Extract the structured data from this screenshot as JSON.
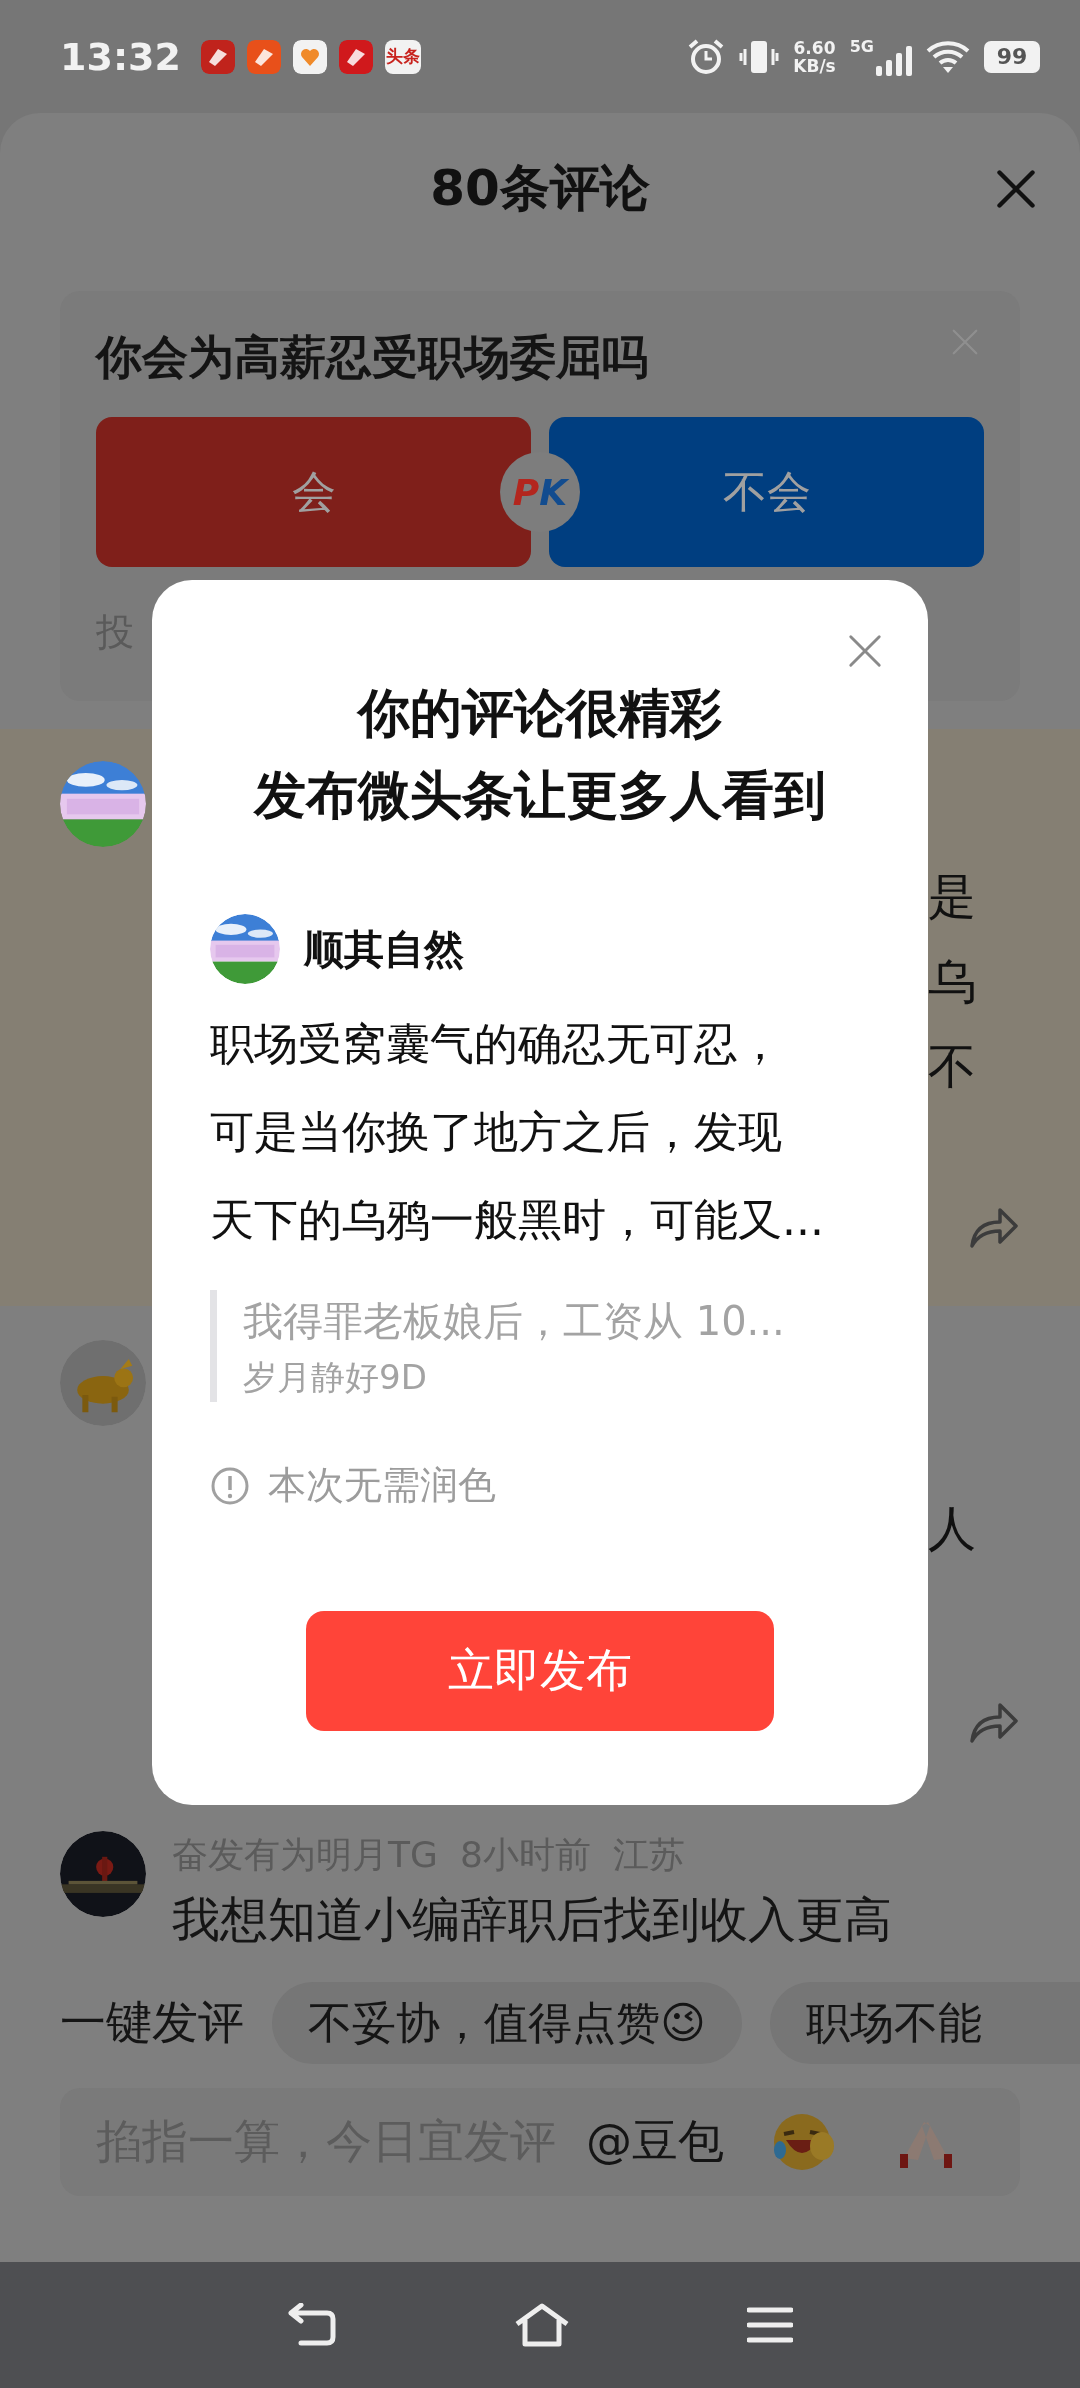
{
  "status_bar": {
    "time": "13:32",
    "app_badge": "头条",
    "speed": "6.60",
    "speed_unit": "KB/s",
    "network": "5G",
    "battery": "99"
  },
  "header": {
    "title": "80条评论"
  },
  "poll": {
    "question": "你会为高薪忍受职场委屈吗",
    "options": [
      {
        "label": "会"
      },
      {
        "label": "不会"
      }
    ],
    "versus": "PK",
    "footer": "投"
  },
  "comments": [
    {
      "kind": "highlighted",
      "fragments": [
        "是",
        "乌",
        "不"
      ]
    },
    {
      "kind": "plain",
      "fragments": [
        "人"
      ]
    },
    {
      "kind": "full",
      "author": "奋发有为明月TG",
      "time": "8小时前",
      "location": "江苏",
      "text": "我想知道小编辞职后找到收入更高"
    }
  ],
  "quick_reply": {
    "label": "一键发评",
    "chips": [
      "不妥协，值得点赞😉",
      "职场不能"
    ]
  },
  "composer": {
    "placeholder": "掐指一算，今日宜发评",
    "mention": "@豆包"
  },
  "dialog": {
    "title_lines": [
      "你的评论很精彩",
      "发布微头条让更多人看到"
    ],
    "author": "顺其自然",
    "body_lines": [
      "职场受窝囊气的确忍无可忍，",
      "可是当你换了地方之后，发现",
      "天下的乌鸦一般黑时，可能又..."
    ],
    "quote": "我得罪老板娘后，工资从 10...",
    "quote_author": "岁月静好9D",
    "notice": "本次无需润色",
    "action": "立即发布"
  }
}
